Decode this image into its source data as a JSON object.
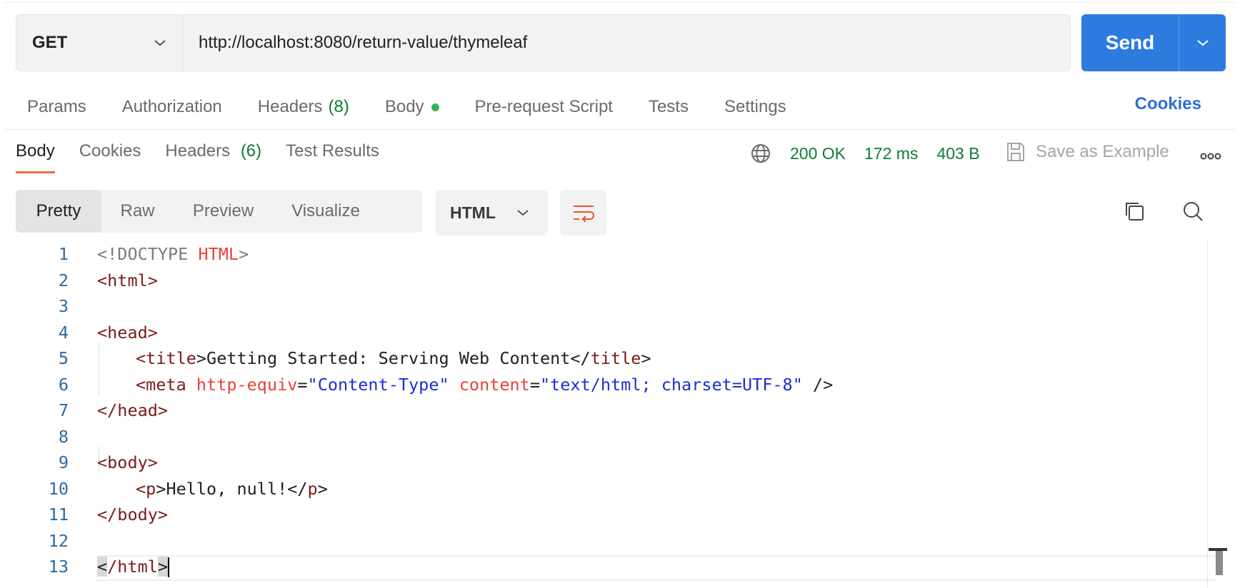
{
  "request": {
    "method": "GET",
    "url": "http://localhost:8080/return-value/thymeleaf",
    "send_label": "Send"
  },
  "request_tabs": [
    {
      "label": "Params"
    },
    {
      "label": "Authorization"
    },
    {
      "label": "Headers",
      "count": "(8)"
    },
    {
      "label": "Body",
      "has_dot": true
    },
    {
      "label": "Pre-request Script"
    },
    {
      "label": "Tests"
    },
    {
      "label": "Settings"
    }
  ],
  "cookies_link": "Cookies",
  "response_tabs": [
    {
      "label": "Body",
      "active": true
    },
    {
      "label": "Cookies"
    },
    {
      "label": "Headers",
      "count": "(6)"
    },
    {
      "label": "Test Results"
    }
  ],
  "response_status": {
    "status": "200 OK",
    "time": "172 ms",
    "size": "403 B",
    "save_label": "Save as Example",
    "status_color": "#0f7b36"
  },
  "format_options": [
    "Pretty",
    "Raw",
    "Preview",
    "Visualize"
  ],
  "format_active": "Pretty",
  "language": "HTML",
  "code_lines": [
    "1",
    "2",
    "3",
    "4",
    "5",
    "6",
    "7",
    "8",
    "9",
    "10",
    "11",
    "12",
    "13"
  ],
  "code": {
    "l1_a": "<!DOCTYPE ",
    "l1_b": "HTML",
    "l1_c": ">",
    "l2": "<html>",
    "l4": "<head>",
    "l5_a": "<",
    "l5_tag": "title",
    "l5_b": ">Getting Started: Serving Web Content</",
    "l5_tag2": "title",
    "l5_c": ">",
    "l6_a": "<",
    "l6_tag": "meta",
    "l6_attr1": "http-equiv",
    "l6_eq1": "=",
    "l6_val1": "\"Content-Type\"",
    "l6_attr2": "content",
    "l6_eq2": "=",
    "l6_val2": "\"text/html; charset=UTF-8\"",
    "l6_end": " />",
    "l7": "</head>",
    "l9": "<body>",
    "l10_a": "<",
    "l10_tag": "p",
    "l10_b": ">Hello, null!</",
    "l10_tag2": "p",
    "l10_c": ">",
    "l11": "</body>",
    "l13_a": "<",
    "l13_b": "/html",
    "l13_c": ">"
  },
  "colors": {
    "accent": "#2e7be0",
    "tab_underline": "#f26b3a",
    "link": "#2e6fd6"
  }
}
